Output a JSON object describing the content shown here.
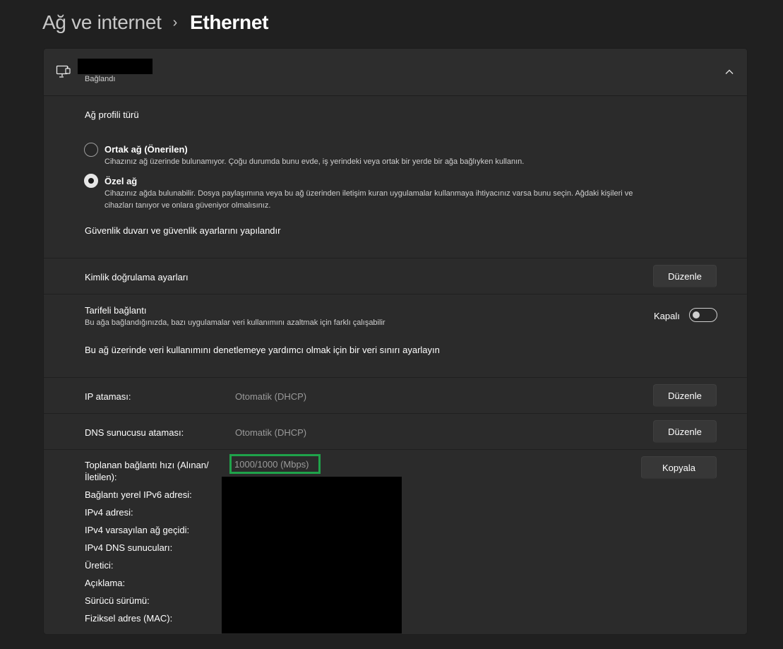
{
  "breadcrumb": {
    "parent": "Ağ ve internet",
    "separator": "›",
    "current": "Ethernet"
  },
  "header": {
    "icon": "ethernet-icon",
    "status": "Bağlandı",
    "collapse_icon": "chevron-up-icon"
  },
  "profile": {
    "title": "Ağ profili türü",
    "public": {
      "label": "Ortak ağ (Önerilen)",
      "desc": "Cihazınız ağ üzerinde bulunamıyor. Çoğu durumda bunu evde, iş yerindeki veya ortak bir yerde bir ağa bağlıyken kullanın.",
      "selected": false
    },
    "private": {
      "label": "Özel ağ",
      "desc_line1": "Cihazınız ağda bulunabilir. Dosya paylaşımına veya bu ağ üzerinden iletişim kuran uygulamalar kullanmaya ihtiyacınız varsa bunu seçin. Ağdaki kişileri ve",
      "desc_line2": "cihazları tanıyor ve onlara güveniyor olmalısınız.",
      "selected": true
    },
    "firewall_link": "Güvenlik duvarı ve güvenlik ayarlarını yapılandır"
  },
  "auth": {
    "label": "Kimlik doğrulama ayarları",
    "button": "Düzenle"
  },
  "metered": {
    "label": "Tarifeli bağlantı",
    "desc": "Bu ağa bağlandığınızda, bazı uygulamalar veri kullanımını azaltmak için farklı çalışabilir",
    "state_label": "Kapalı",
    "on": false,
    "data_limit_link": "Bu ağ üzerinde veri kullanımını denetlemeye yardımcı olmak için bir veri sınırı ayarlayın"
  },
  "ip": {
    "label": "IP ataması:",
    "value": "Otomatik (DHCP)",
    "button": "Düzenle"
  },
  "dns": {
    "label": "DNS sunucusu ataması:",
    "value": "Otomatik (DHCP)",
    "button": "Düzenle"
  },
  "properties": {
    "speed_label_line1": "Toplanan bağlantı hızı (Alınan/",
    "speed_label_line2": "İletilen):",
    "speed_value": "1000/1000 (Mbps)",
    "copy_button": "Kopyala",
    "rows": [
      "Bağlantı yerel IPv6 adresi:",
      "IPv4 adresi:",
      "IPv4 varsayılan ağ geçidi:",
      "IPv4 DNS sunucuları:",
      "Üretici:",
      "Açıklama:",
      "Sürücü sürümü:",
      "Fiziksel adres (MAC):"
    ]
  },
  "colors": {
    "background": "#202020",
    "card": "#2b2b2b",
    "highlight": "#1fa34a"
  }
}
